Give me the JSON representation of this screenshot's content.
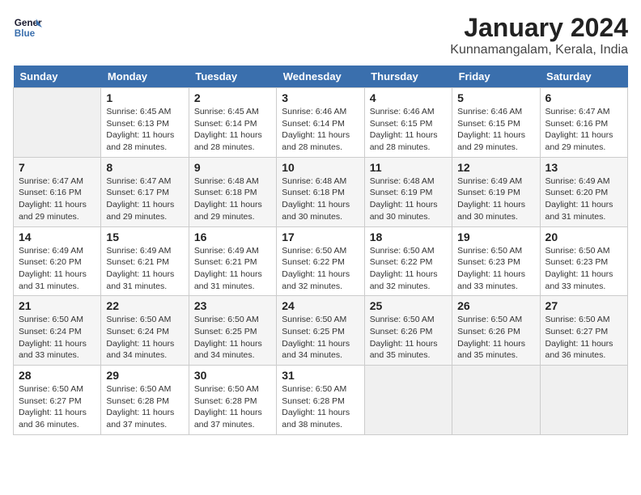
{
  "header": {
    "logo_line1": "General",
    "logo_line2": "Blue",
    "title": "January 2024",
    "subtitle": "Kunnamangalam, Kerala, India"
  },
  "days_of_week": [
    "Sunday",
    "Monday",
    "Tuesday",
    "Wednesday",
    "Thursday",
    "Friday",
    "Saturday"
  ],
  "weeks": [
    [
      {
        "day": "",
        "detail": ""
      },
      {
        "day": "1",
        "detail": "Sunrise: 6:45 AM\nSunset: 6:13 PM\nDaylight: 11 hours\nand 28 minutes."
      },
      {
        "day": "2",
        "detail": "Sunrise: 6:45 AM\nSunset: 6:14 PM\nDaylight: 11 hours\nand 28 minutes."
      },
      {
        "day": "3",
        "detail": "Sunrise: 6:46 AM\nSunset: 6:14 PM\nDaylight: 11 hours\nand 28 minutes."
      },
      {
        "day": "4",
        "detail": "Sunrise: 6:46 AM\nSunset: 6:15 PM\nDaylight: 11 hours\nand 28 minutes."
      },
      {
        "day": "5",
        "detail": "Sunrise: 6:46 AM\nSunset: 6:15 PM\nDaylight: 11 hours\nand 29 minutes."
      },
      {
        "day": "6",
        "detail": "Sunrise: 6:47 AM\nSunset: 6:16 PM\nDaylight: 11 hours\nand 29 minutes."
      }
    ],
    [
      {
        "day": "7",
        "detail": "Sunrise: 6:47 AM\nSunset: 6:16 PM\nDaylight: 11 hours\nand 29 minutes."
      },
      {
        "day": "8",
        "detail": "Sunrise: 6:47 AM\nSunset: 6:17 PM\nDaylight: 11 hours\nand 29 minutes."
      },
      {
        "day": "9",
        "detail": "Sunrise: 6:48 AM\nSunset: 6:18 PM\nDaylight: 11 hours\nand 29 minutes."
      },
      {
        "day": "10",
        "detail": "Sunrise: 6:48 AM\nSunset: 6:18 PM\nDaylight: 11 hours\nand 30 minutes."
      },
      {
        "day": "11",
        "detail": "Sunrise: 6:48 AM\nSunset: 6:19 PM\nDaylight: 11 hours\nand 30 minutes."
      },
      {
        "day": "12",
        "detail": "Sunrise: 6:49 AM\nSunset: 6:19 PM\nDaylight: 11 hours\nand 30 minutes."
      },
      {
        "day": "13",
        "detail": "Sunrise: 6:49 AM\nSunset: 6:20 PM\nDaylight: 11 hours\nand 31 minutes."
      }
    ],
    [
      {
        "day": "14",
        "detail": "Sunrise: 6:49 AM\nSunset: 6:20 PM\nDaylight: 11 hours\nand 31 minutes."
      },
      {
        "day": "15",
        "detail": "Sunrise: 6:49 AM\nSunset: 6:21 PM\nDaylight: 11 hours\nand 31 minutes."
      },
      {
        "day": "16",
        "detail": "Sunrise: 6:49 AM\nSunset: 6:21 PM\nDaylight: 11 hours\nand 31 minutes."
      },
      {
        "day": "17",
        "detail": "Sunrise: 6:50 AM\nSunset: 6:22 PM\nDaylight: 11 hours\nand 32 minutes."
      },
      {
        "day": "18",
        "detail": "Sunrise: 6:50 AM\nSunset: 6:22 PM\nDaylight: 11 hours\nand 32 minutes."
      },
      {
        "day": "19",
        "detail": "Sunrise: 6:50 AM\nSunset: 6:23 PM\nDaylight: 11 hours\nand 33 minutes."
      },
      {
        "day": "20",
        "detail": "Sunrise: 6:50 AM\nSunset: 6:23 PM\nDaylight: 11 hours\nand 33 minutes."
      }
    ],
    [
      {
        "day": "21",
        "detail": "Sunrise: 6:50 AM\nSunset: 6:24 PM\nDaylight: 11 hours\nand 33 minutes."
      },
      {
        "day": "22",
        "detail": "Sunrise: 6:50 AM\nSunset: 6:24 PM\nDaylight: 11 hours\nand 34 minutes."
      },
      {
        "day": "23",
        "detail": "Sunrise: 6:50 AM\nSunset: 6:25 PM\nDaylight: 11 hours\nand 34 minutes."
      },
      {
        "day": "24",
        "detail": "Sunrise: 6:50 AM\nSunset: 6:25 PM\nDaylight: 11 hours\nand 34 minutes."
      },
      {
        "day": "25",
        "detail": "Sunrise: 6:50 AM\nSunset: 6:26 PM\nDaylight: 11 hours\nand 35 minutes."
      },
      {
        "day": "26",
        "detail": "Sunrise: 6:50 AM\nSunset: 6:26 PM\nDaylight: 11 hours\nand 35 minutes."
      },
      {
        "day": "27",
        "detail": "Sunrise: 6:50 AM\nSunset: 6:27 PM\nDaylight: 11 hours\nand 36 minutes."
      }
    ],
    [
      {
        "day": "28",
        "detail": "Sunrise: 6:50 AM\nSunset: 6:27 PM\nDaylight: 11 hours\nand 36 minutes."
      },
      {
        "day": "29",
        "detail": "Sunrise: 6:50 AM\nSunset: 6:28 PM\nDaylight: 11 hours\nand 37 minutes."
      },
      {
        "day": "30",
        "detail": "Sunrise: 6:50 AM\nSunset: 6:28 PM\nDaylight: 11 hours\nand 37 minutes."
      },
      {
        "day": "31",
        "detail": "Sunrise: 6:50 AM\nSunset: 6:28 PM\nDaylight: 11 hours\nand 38 minutes."
      },
      {
        "day": "",
        "detail": ""
      },
      {
        "day": "",
        "detail": ""
      },
      {
        "day": "",
        "detail": ""
      }
    ]
  ]
}
